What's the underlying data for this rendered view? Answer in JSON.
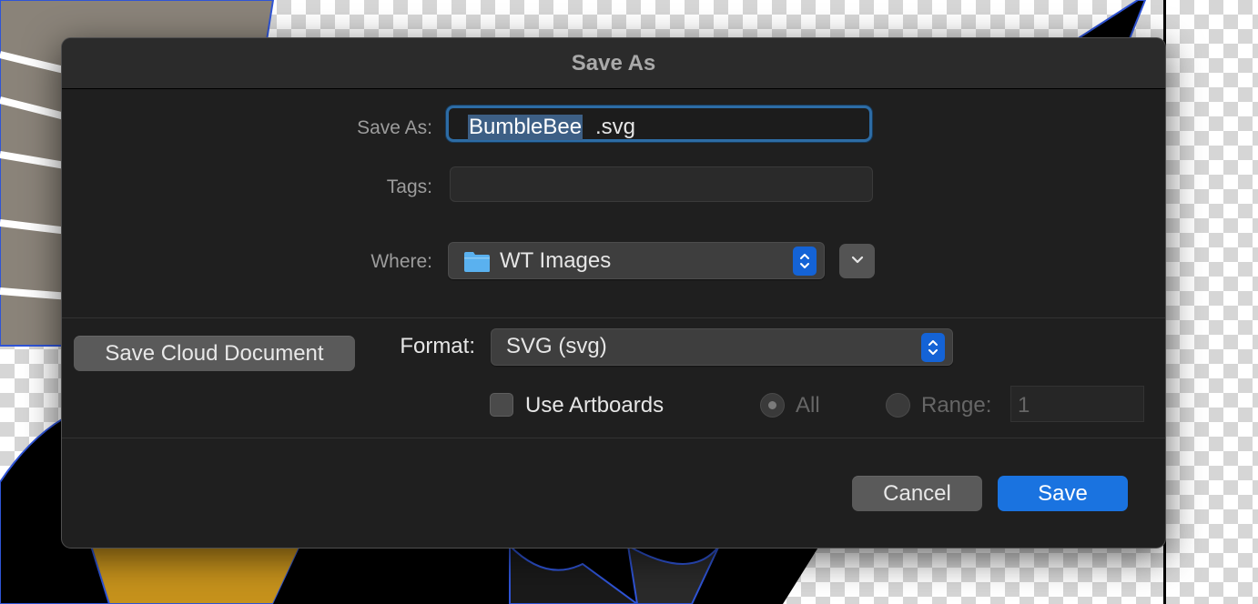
{
  "dialog": {
    "title": "Save As",
    "save_as_label": "Save As:",
    "filename_selected": "BumbleBee",
    "filename_extension": ".svg",
    "tags_label": "Tags:",
    "tags_value": "",
    "where_label": "Where:",
    "where_value": "WT Images",
    "where_icon": "folder-icon",
    "save_cloud_document_label": "Save Cloud Document",
    "format_label": "Format:",
    "format_value": "SVG (svg)",
    "use_artboards_label": "Use Artboards",
    "use_artboards_checked": false,
    "all_label": "All",
    "range_label": "Range:",
    "range_value": "1",
    "cancel_label": "Cancel",
    "save_label": "Save"
  },
  "colors": {
    "accent": "#1a73e0",
    "dialog_bg": "#1f1f1f",
    "titlebar_bg": "#2b2b2b",
    "folder": "#5ab1ef"
  }
}
